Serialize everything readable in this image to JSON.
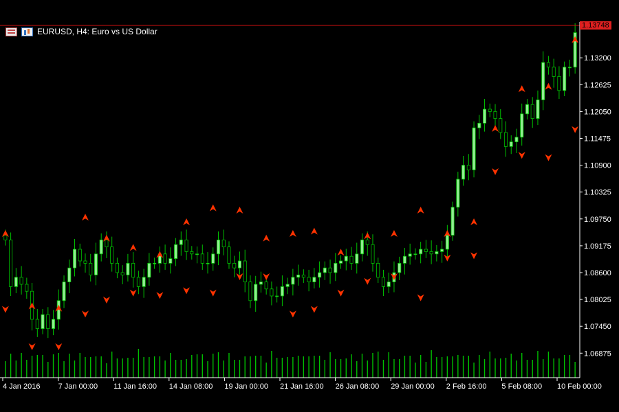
{
  "window": {
    "symbol_title": "EURUSD, H4:  Euro vs US Dollar",
    "current_price": "1.13748"
  },
  "colors": {
    "background": "#000000",
    "bull_candle": "#90ee90",
    "bear_candle": "#000000",
    "wick": "#00c000",
    "volume": "#00c000",
    "arrow": "#ff3300",
    "price_line": "#d01010",
    "axis": "#ffffff"
  },
  "chart_data": {
    "type": "candlestick",
    "symbol": "EURUSD",
    "timeframe": "H4",
    "ylim": [
      1.0635,
      1.1385
    ],
    "y_ticks": [
      "1.13200",
      "1.12625",
      "1.12050",
      "1.11475",
      "1.10900",
      "1.10325",
      "1.09750",
      "1.09175",
      "1.08600",
      "1.08025",
      "1.07450",
      "1.06875"
    ],
    "x_ticks": [
      "4 Jan 2016",
      "7 Jan 00:00",
      "11 Jan 16:00",
      "14 Jan 08:00",
      "19 Jan 00:00",
      "21 Jan 16:00",
      "26 Jan 08:00",
      "29 Jan 00:00",
      "2 Feb 16:00",
      "5 Feb 08:00",
      "10 Feb 00:00"
    ],
    "last_price": 1.13748,
    "close_path": [
      1.093,
      1.083,
      1.085,
      1.0835,
      1.082,
      1.076,
      1.074,
      1.077,
      1.074,
      1.076,
      1.08,
      1.084,
      1.087,
      1.091,
      1.0885,
      1.088,
      1.0855,
      1.09,
      1.093,
      1.0915,
      1.088,
      1.086,
      1.0855,
      1.088,
      1.085,
      1.083,
      1.085,
      1.088,
      1.088,
      1.09,
      1.088,
      1.089,
      1.092,
      1.093,
      1.0905,
      1.09,
      1.09,
      1.088,
      1.088,
      1.09,
      1.093,
      1.0915,
      1.088,
      1.087,
      1.0885,
      1.084,
      1.08,
      1.0835,
      1.084,
      1.0825,
      1.081,
      1.081,
      1.083,
      1.0835,
      1.085,
      1.0855,
      1.085,
      1.084,
      1.085,
      1.086,
      1.087,
      1.086,
      1.088,
      1.0885,
      1.0895,
      1.088,
      1.09,
      1.093,
      1.092,
      1.088,
      1.085,
      1.083,
      1.084,
      1.086,
      1.088,
      1.0895,
      1.09,
      1.09,
      1.091,
      1.0905,
      1.09,
      1.0905,
      1.091,
      1.094,
      1.1,
      1.106,
      1.109,
      1.108,
      1.117,
      1.118,
      1.121,
      1.1205,
      1.119,
      1.116,
      1.113,
      1.114,
      1.115,
      1.12,
      1.122,
      1.119,
      1.123,
      1.131,
      1.13,
      1.128,
      1.125,
      1.13,
      1.13,
      1.1374
    ],
    "up_arrow_lows": [
      1.0935,
      1.078,
      1.0775,
      1.097,
      1.0925,
      1.0905,
      1.089,
      1.096,
      1.099,
      1.0985,
      1.0925,
      1.0935,
      1.094,
      1.0895,
      1.093,
      1.0935,
      1.0985,
      1.0935,
      1.096,
      1.116,
      1.1245,
      1.125,
      1.135
    ],
    "down_arrow_highs": [
      1.079,
      1.071,
      1.071,
      1.078,
      1.081,
      1.0825,
      1.082,
      1.083,
      1.0825,
      1.086,
      1.086,
      1.078,
      1.079,
      1.0825,
      1.085,
      1.086,
      1.0815,
      1.09,
      1.0905,
      1.1085,
      1.112,
      1.1115,
      1.1175
    ],
    "volume_relative": [
      0.4,
      0.5,
      0.35,
      0.45,
      0.3,
      0.55,
      0.4,
      0.5,
      0.35,
      0.45,
      0.6,
      0.4,
      0.5,
      0.35,
      0.45
    ]
  }
}
